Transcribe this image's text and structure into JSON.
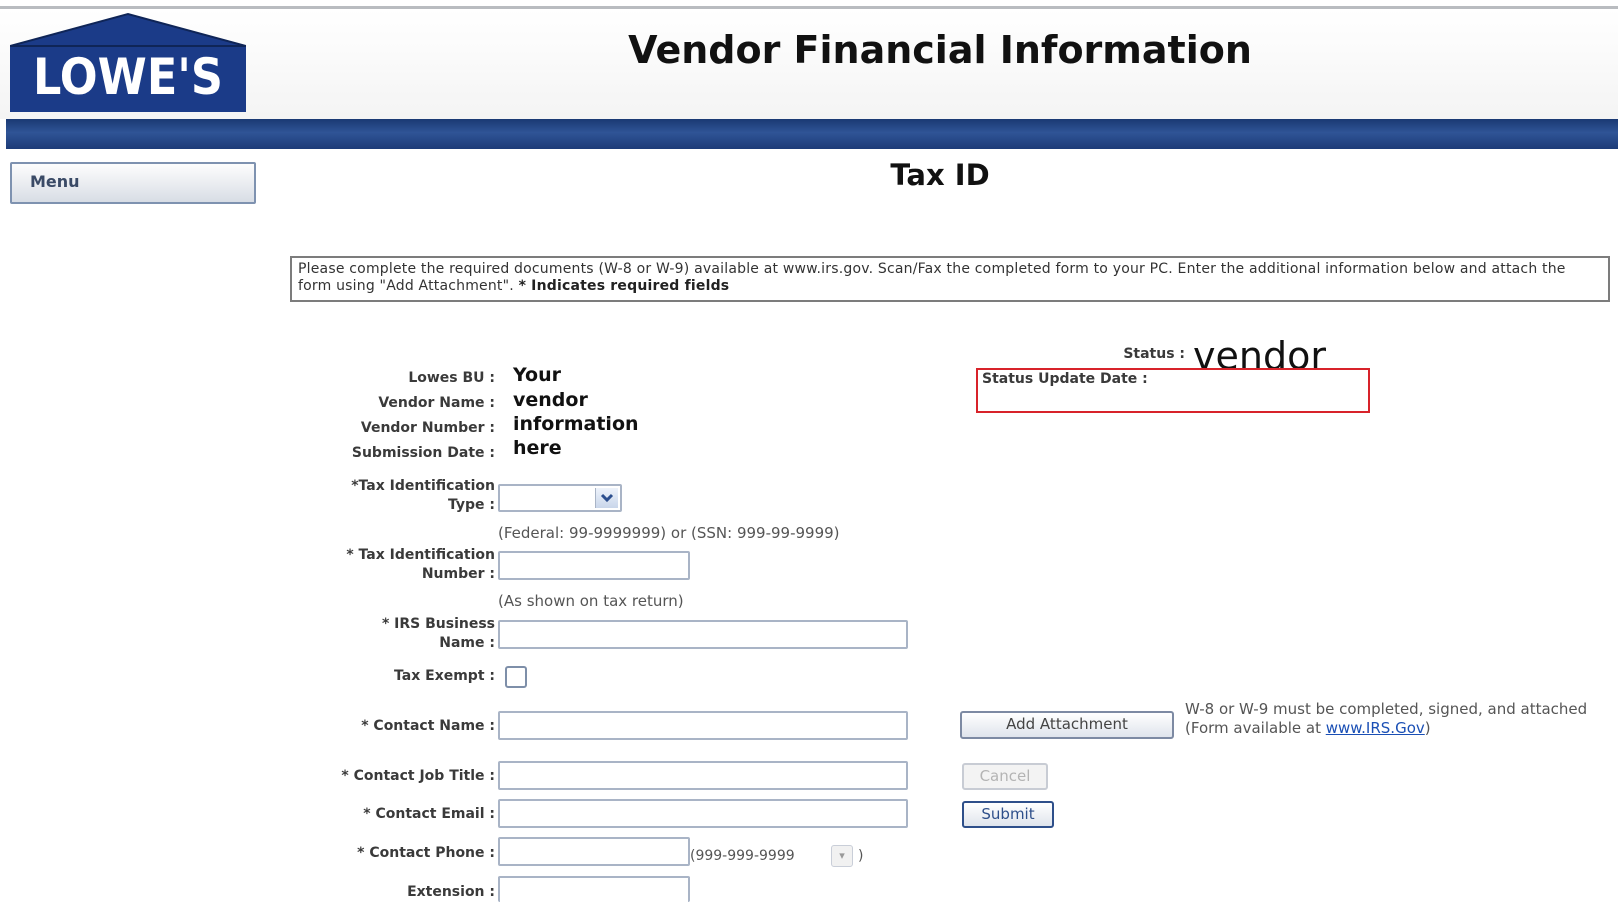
{
  "brand": {
    "logo_text": "LOWE'S",
    "color": "#1b3b88"
  },
  "header": {
    "title": "Vendor Financial Information"
  },
  "nav": {
    "menu_label": "Menu"
  },
  "page": {
    "title": "Tax ID"
  },
  "instructions": {
    "text": "Please complete the required documents (W-8 or W-9) available at www.irs.gov. Scan/Fax the completed form to your PC. Enter the additional information below and attach the form using \"Add Attachment\". ",
    "required_note": "* Indicates required fields"
  },
  "status": {
    "label": "Status :",
    "value": "vendor",
    "update_date_label": "Status Update Date :"
  },
  "vendor_info": {
    "labels": {
      "bu": "Lowes BU :",
      "name": "Vendor Name :",
      "number": "Vendor Number :",
      "date": "Submission Date :"
    },
    "placeholder_lines": [
      "Your",
      "vendor",
      "information",
      "here"
    ]
  },
  "form": {
    "tax_type": {
      "label1": "*Tax Identification",
      "label2": "Type :",
      "value": ""
    },
    "tax_hint": "(Federal: 99-9999999) or (SSN: 999-99-9999)",
    "tax_number": {
      "label1": "* Tax Identification",
      "label2": "Number :",
      "value": ""
    },
    "tax_number_hint": "(As shown on tax return)",
    "irs_name": {
      "label1": "* IRS Business",
      "label2": "Name :",
      "value": ""
    },
    "tax_exempt": {
      "label": "Tax Exempt :",
      "checked": false
    },
    "contact_name": {
      "label": "* Contact Name :",
      "value": ""
    },
    "contact_job_title": {
      "label": "* Contact Job Title :",
      "value": ""
    },
    "contact_email": {
      "label": "* Contact Email :",
      "value": ""
    },
    "contact_phone": {
      "label": "* Contact Phone :",
      "value": "",
      "format": "(999-999-9999",
      "format_close": ")"
    },
    "extension": {
      "label": "Extension :",
      "value": ""
    }
  },
  "actions": {
    "add_attachment": "Add Attachment",
    "cancel": "Cancel",
    "submit": "Submit",
    "attachment_note": "W-8 or W-9 must be completed, signed, and attached",
    "form_available_prefix": "(Form available at ",
    "form_available_link": "www.IRS.Gov",
    "form_available_suffix": ")"
  }
}
